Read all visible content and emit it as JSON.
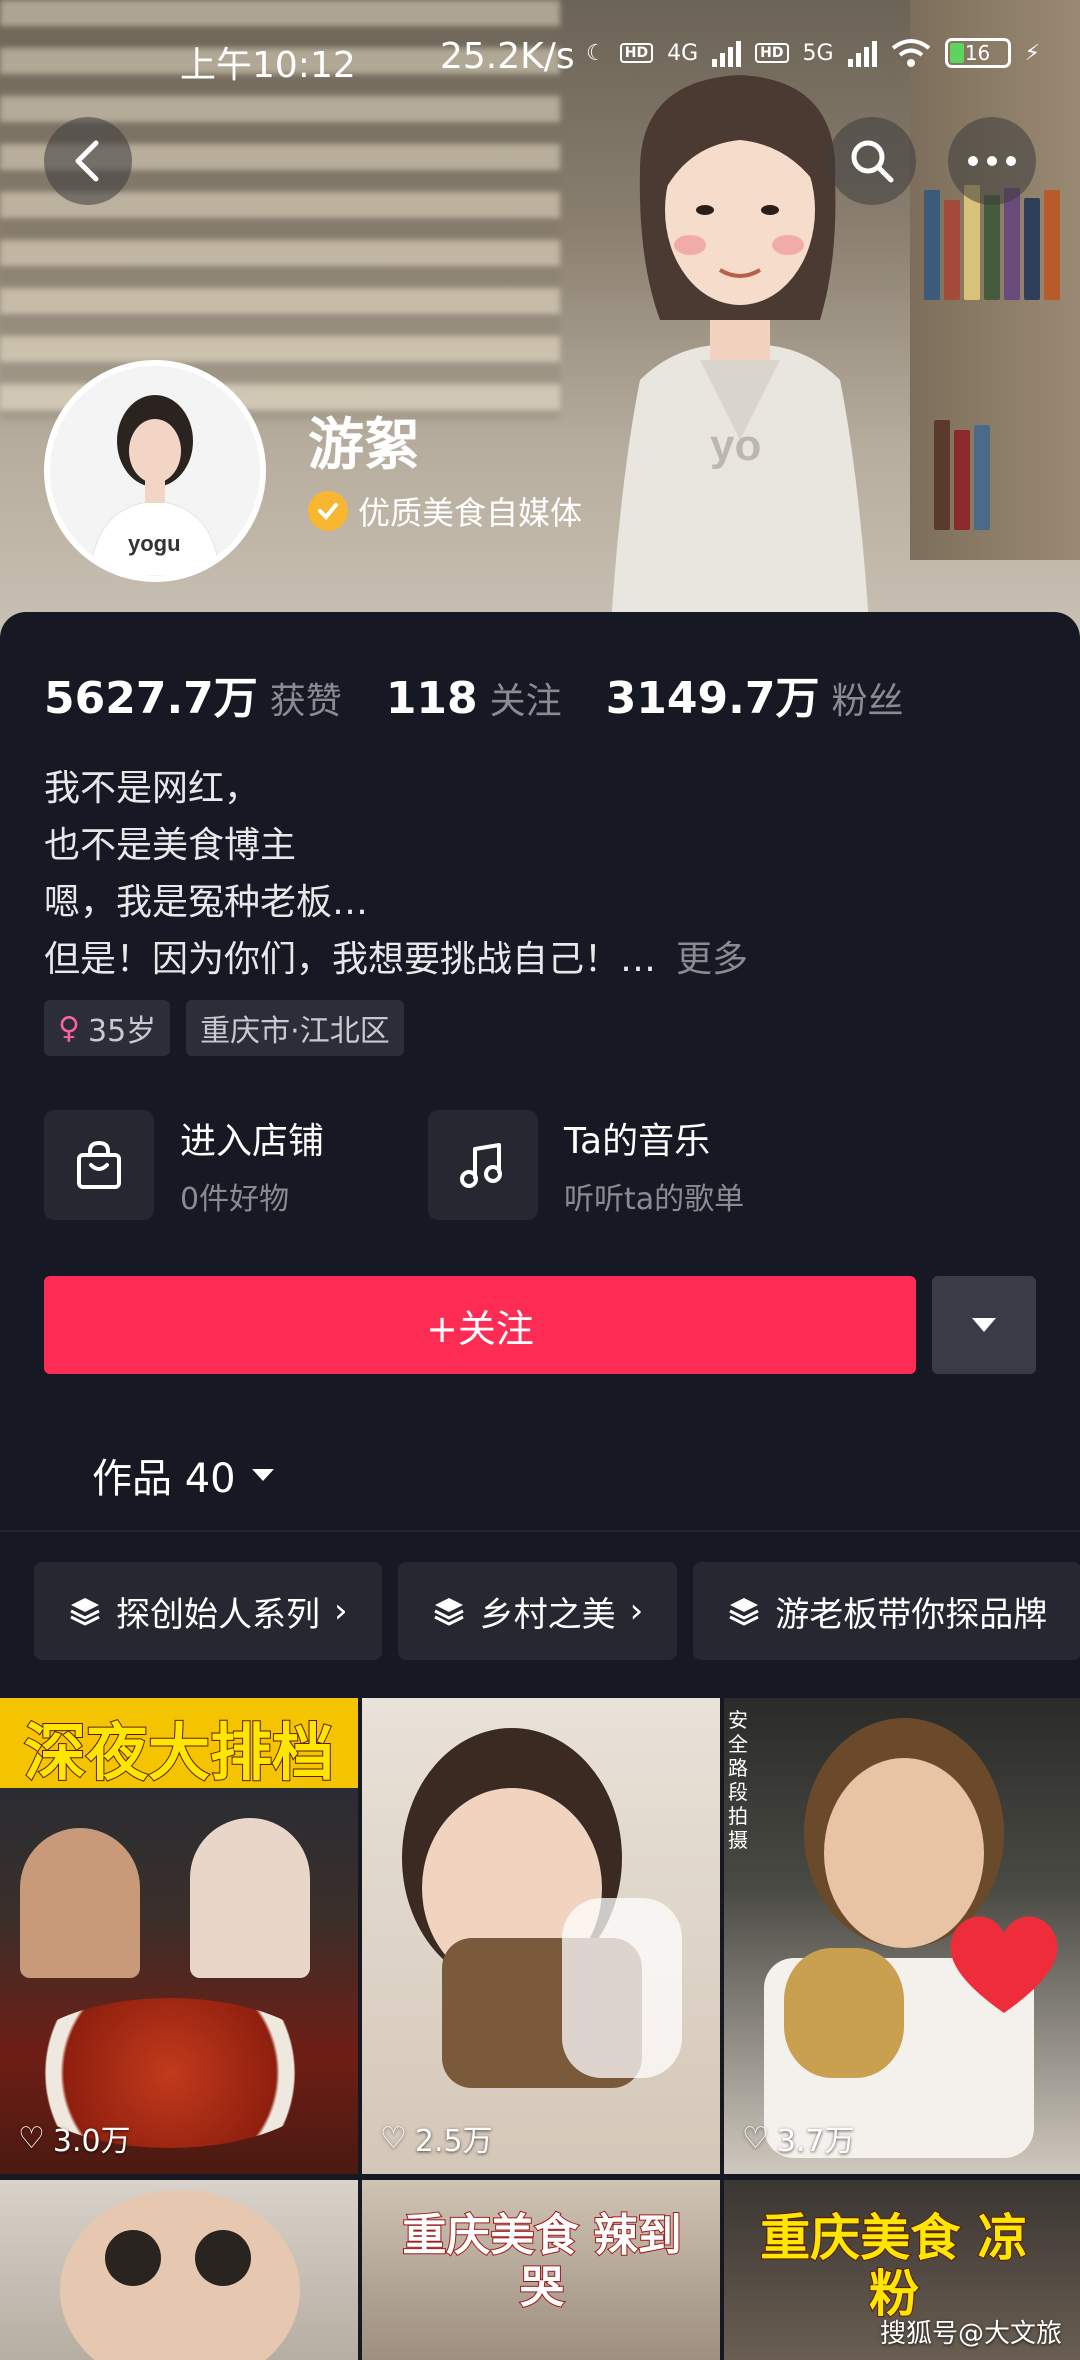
{
  "status_bar": {
    "time": "上午10:12",
    "network_speed": "25.2K/s",
    "signal_1": "4G",
    "signal_2": "5G",
    "battery": "16"
  },
  "header": {
    "back_icon": "chevron-left-icon",
    "search_icon": "search-icon",
    "more_icon": "more-dots-icon"
  },
  "profile": {
    "name": "游絮",
    "verified_label": "优质美食自媒体",
    "stats": [
      {
        "num": "5627.7万",
        "label": "获赞"
      },
      {
        "num": "118",
        "label": "关注"
      },
      {
        "num": "3149.7万",
        "label": "粉丝"
      }
    ],
    "bio_lines": [
      "我不是网红，",
      "也不是美食博主",
      "嗯，我是冤种老板…",
      "但是！因为你们，我想要挑战自己！…"
    ],
    "bio_more": "更多",
    "tags": {
      "age": "35岁",
      "location": "重庆市·江北区"
    }
  },
  "entries": {
    "shop": {
      "title": "进入店铺",
      "subtitle": "0件好物"
    },
    "music": {
      "title": "Ta的音乐",
      "subtitle": "听听ta的歌单"
    }
  },
  "actions": {
    "follow_label": "+关注"
  },
  "works": {
    "label": "作品 40"
  },
  "collections": [
    {
      "label": "探创始人系列"
    },
    {
      "label": "乡村之美"
    },
    {
      "label": "游老板带你探品牌"
    }
  ],
  "videos": [
    {
      "title": "深夜大排档",
      "likes": "3.0万"
    },
    {
      "title": "",
      "likes": "2.5万",
      "corner_text": "安全路段拍摄"
    },
    {
      "title": "",
      "likes": "3.7万"
    },
    {
      "title": "",
      "likes": ""
    },
    {
      "title": "重庆美食 辣到哭",
      "likes": ""
    },
    {
      "title": "重庆美食 凉粉",
      "likes": ""
    }
  ],
  "watermark": "搜狐号@大文旅",
  "colors": {
    "background": "#161823",
    "follow_button": "#fe2c55",
    "verified_badge": "#f7b731",
    "secondary_text": "#8a8b91"
  }
}
